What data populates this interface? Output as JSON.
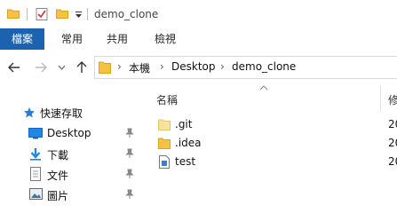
{
  "window": {
    "title": "demo_clone"
  },
  "ribbon": {
    "tabs": [
      "檔案",
      "常用",
      "共用",
      "檢視"
    ]
  },
  "address": {
    "crumbs": [
      "本機",
      "Desktop",
      "demo_clone"
    ]
  },
  "sidebar": {
    "quick_access": "快速存取",
    "items": [
      "Desktop",
      "下載",
      "文件",
      "圖片"
    ]
  },
  "columns": {
    "name": "名稱",
    "date": "修"
  },
  "files": [
    {
      "name": ".git",
      "type": "folder",
      "date": "20"
    },
    {
      "name": ".idea",
      "type": "folder",
      "date": "20"
    },
    {
      "name": "test",
      "type": "file",
      "date": "20"
    }
  ],
  "colors": {
    "accent": "#1b63b0",
    "folder": "#f5c342"
  }
}
